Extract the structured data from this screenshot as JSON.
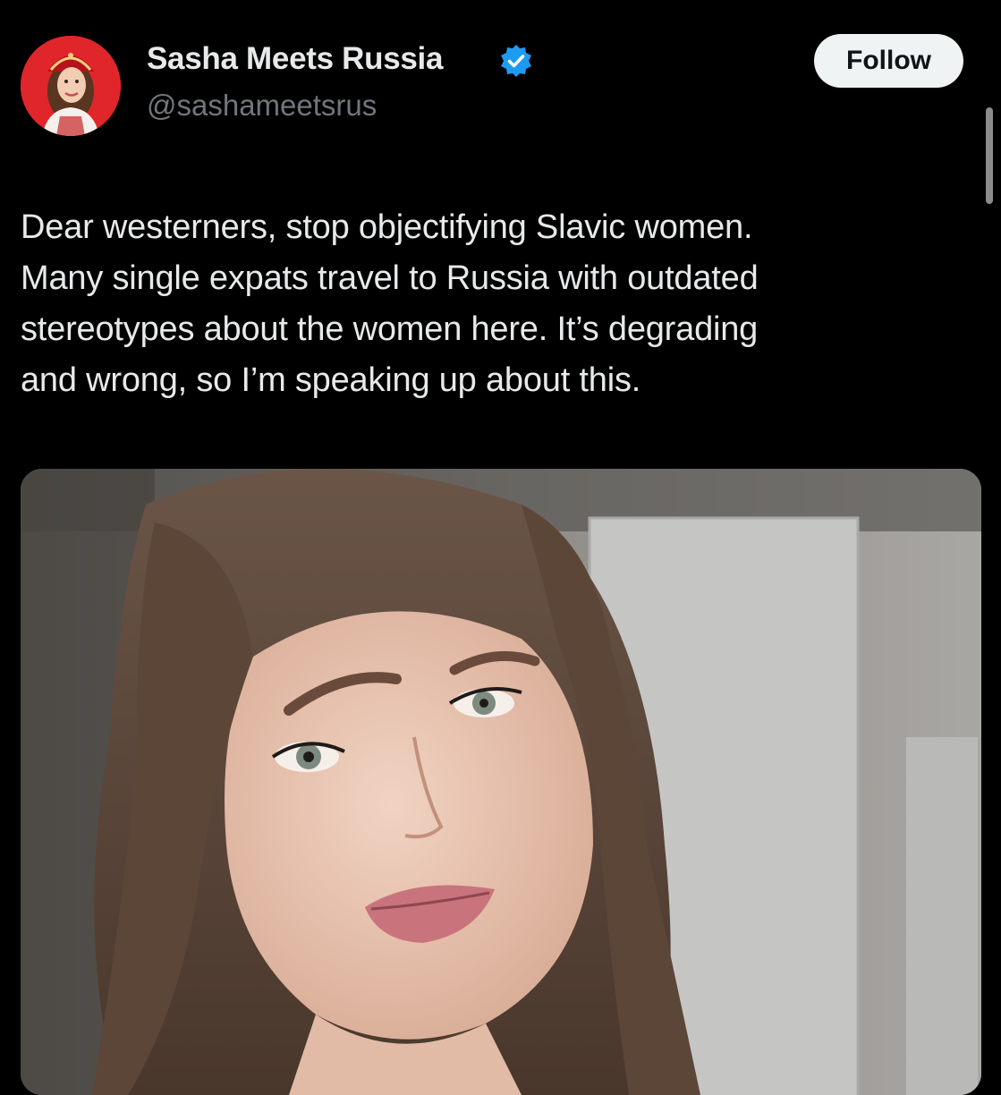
{
  "author": {
    "display_name": "Sasha Meets Russia",
    "handle": "@sashameetsrus",
    "verified": true,
    "avatar_icon": "profile-photo"
  },
  "follow_button": {
    "label": "Follow"
  },
  "post": {
    "text": "Dear westerners, stop objectifying Slavic women.\nMany single expats travel to Russia with outdated\nstereotypes about the women here. It’s degrading\nand wrong, so I’m speaking up about this."
  },
  "media": {
    "type": "video-still",
    "subject_icon": "woman-speaking-photo"
  },
  "colors": {
    "background": "#000000",
    "text": "#e7e9ea",
    "secondary_text": "#71767b",
    "verified": "#1d9bf0",
    "follow_button_bg": "#eff3f4"
  }
}
